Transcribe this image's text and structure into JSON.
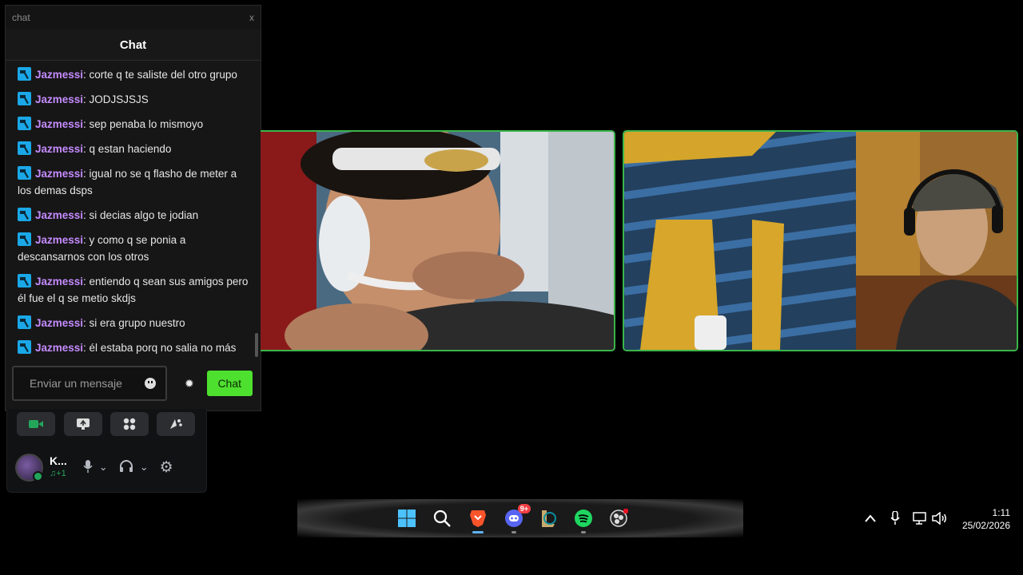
{
  "window": {
    "title": "chat",
    "close": "x"
  },
  "chat": {
    "header": "Chat",
    "messages": [
      {
        "user": "Jazmessi",
        "text": ": corte q te saliste del otro grupo"
      },
      {
        "user": "Jazmessi",
        "text": ": JODJSJSJS"
      },
      {
        "user": "Jazmessi",
        "text": ": sep penaba lo mismoyo"
      },
      {
        "user": "Jazmessi",
        "text": ": q estan haciendo"
      },
      {
        "user": "Jazmessi",
        "text": ": igual no se q flasho de meter a los demas dsps"
      },
      {
        "user": "Jazmessi",
        "text": ": si decias algo te jodian"
      },
      {
        "user": "Jazmessi",
        "text": ": y como q se ponia a descansarnos con los otros"
      },
      {
        "user": "Jazmessi",
        "text": ": entiendo q sean sus amigos pero él fue el q se metio skdjs"
      },
      {
        "user": "Jazmessi",
        "text": ": si era grupo nuestro"
      },
      {
        "user": "Jazmessi",
        "text": ": él estaba porq no salia no más"
      }
    ],
    "input_placeholder": "Enviar un mensaje",
    "send_label": "Chat",
    "badge_color": "#1aa8e8",
    "username_color": "#c58bff",
    "send_color": "#4ee02f"
  },
  "voice_panel": {
    "buttons": [
      "camera-icon",
      "screen-share-icon",
      "activities-icon",
      "soundboard-icon"
    ],
    "user": {
      "name": "K...",
      "status": "♫+1"
    }
  },
  "taskbar": {
    "apps": [
      "windows-start-icon",
      "search-icon",
      "brave-icon",
      "discord-icon",
      "league-icon",
      "spotify-icon",
      "obs-icon"
    ],
    "discord_badge": "9+",
    "time": "1:11",
    "date": "25/02/2026"
  },
  "tile_border_color": "#3bb54a"
}
